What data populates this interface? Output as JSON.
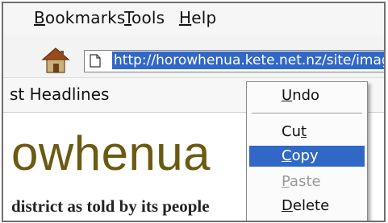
{
  "menubar": {
    "items": [
      {
        "underline": "B",
        "rest": "ookmarks"
      },
      {
        "underline": "T",
        "rest": "ools"
      },
      {
        "underline": "H",
        "rest": "elp"
      }
    ]
  },
  "toolbar": {
    "home_icon": "home-icon",
    "page_icon": "page-icon",
    "url": "http://horowhenua.kete.net.nz/site/images"
  },
  "tab": {
    "label": "st Headlines"
  },
  "page": {
    "site_title": "owhenua",
    "tagline": "district as told by its people"
  },
  "context_menu": {
    "undo": {
      "underline": "U",
      "rest": "ndo"
    },
    "cut": {
      "pre": "Cu",
      "underline": "t"
    },
    "copy": {
      "underline": "C",
      "rest": "opy"
    },
    "paste": {
      "underline": "P",
      "rest": "aste"
    },
    "delete": {
      "underline": "D",
      "rest": "elete"
    }
  },
  "colors": {
    "selection": "#3168c6",
    "site_title": "#6b5a12"
  }
}
